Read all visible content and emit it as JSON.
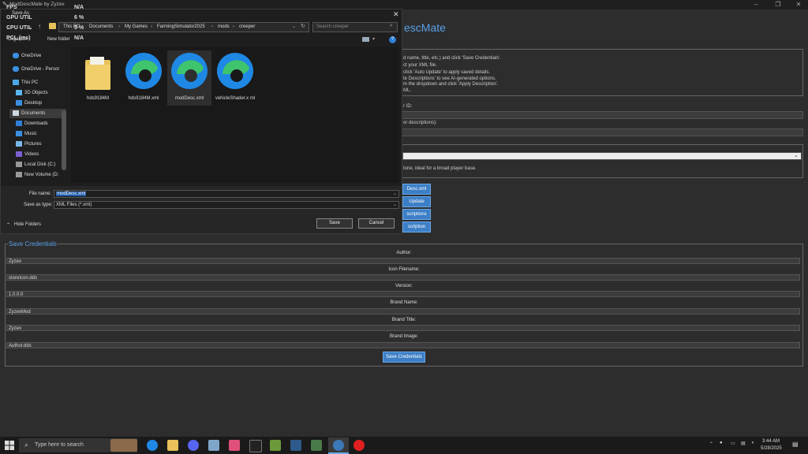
{
  "app": {
    "title": "ModDescMate by Zyzex",
    "heading": "escMate",
    "instructions": [
      "d name, title, etc.) and click 'Save Credentials'.",
      "ct your XML file.",
      "click 'Auto Update' to apply saved details.",
      "te Descriptions' to see AI-generated options.",
      "m the dropdown and click 'Apply Description'.",
      "ML."
    ],
    "field_labels": [
      "r ID:",
      "or descriptions):"
    ],
    "tone_text": "tone, ideal for a broad player base.",
    "buttons": [
      "Desc.xml",
      "Update",
      "scriptions",
      "scription"
    ]
  },
  "overlay": {
    "rows": [
      {
        "label": "FPS",
        "value": "N/A"
      },
      {
        "label": "GPU UTIL",
        "value": "6 %"
      },
      {
        "label": "CPU UTIL",
        "value": "5 %"
      },
      {
        "label": "PCL (ms)",
        "value": "N/A"
      }
    ]
  },
  "dialog": {
    "title": "Save As",
    "breadcrumb": [
      "This PC",
      "Documents",
      "My Games",
      "FarmingSimulator2025",
      "mods",
      "creeper"
    ],
    "search_placeholder": "Search creeper",
    "organize": "Organize",
    "new_folder": "New folder",
    "nav": [
      {
        "label": "OneDrive",
        "icon": "cloud-icon"
      },
      {
        "label": "OneDrive - Persor",
        "icon": "cloud-icon"
      },
      {
        "label": "This PC",
        "icon": "computer-icon"
      },
      {
        "label": "3D Objects",
        "icon": "cube-icon"
      },
      {
        "label": "Desktop",
        "icon": "desktop-icon"
      },
      {
        "label": "Documents",
        "icon": "document-icon"
      },
      {
        "label": "Downloads",
        "icon": "download-icon"
      },
      {
        "label": "Music",
        "icon": "music-icon"
      },
      {
        "label": "Pictures",
        "icon": "pictures-icon"
      },
      {
        "label": "Videos",
        "icon": "video-icon"
      },
      {
        "label": "Local Disk (C:)",
        "icon": "disk-icon"
      },
      {
        "label": "New Volume (D:",
        "icon": "disk-icon"
      }
    ],
    "files": [
      {
        "name": "hds9184M",
        "type": "folder"
      },
      {
        "name": "hds9184M.xml",
        "type": "edge"
      },
      {
        "name": "modDesc.xml",
        "type": "edge"
      },
      {
        "name": "vehicleShader.x ml",
        "type": "edge"
      }
    ],
    "file_name_label": "File name:",
    "file_name_value": "modDesc.xml",
    "save_type_label": "Save as type:",
    "save_type_value": "XML Files (*.xml)",
    "hide_folders": "Hide Folders",
    "save": "Save",
    "cancel": "Cancel"
  },
  "credentials": {
    "legend": "Save Credentials",
    "fields": [
      {
        "label": "Author:",
        "value": "Zyzex"
      },
      {
        "label": "Icon Filename:",
        "value": "storeIcon.dds"
      },
      {
        "label": "Version:",
        "value": "1.0.0.0"
      },
      {
        "label": "Brand Name:",
        "value": "ZyzexMod"
      },
      {
        "label": "Brand Title:",
        "value": "Zyzex"
      },
      {
        "label": "Brand Image:",
        "value": "Author.dds"
      }
    ],
    "save_button": "Save Credentials"
  },
  "taskbar": {
    "search_placeholder": "Type here to search",
    "time": "3:44 AM",
    "date": "5/28/2025"
  },
  "colors": {
    "accent": "#3d7fc6",
    "heading": "#5aa0e6",
    "edge_blue": "#1f88e5",
    "edge_green": "#3ec46d",
    "folder": "#e8c15a"
  }
}
